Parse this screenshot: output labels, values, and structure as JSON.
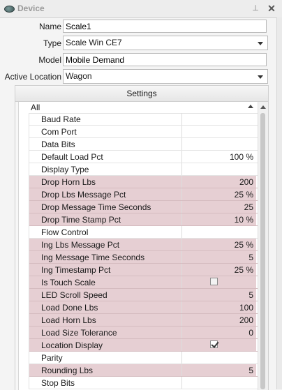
{
  "window": {
    "title": "Device",
    "icon": "device-icon",
    "pin_glyph": "📌",
    "close_glyph": "✕"
  },
  "form": {
    "name": {
      "label": "Name",
      "value": "Scale1"
    },
    "type": {
      "label": "Type",
      "value": "Scale Win CE7"
    },
    "model": {
      "label": "Model",
      "value": "Mobile Demand"
    },
    "location": {
      "label": "Active Location",
      "value": "Wagon"
    }
  },
  "settings": {
    "header": "Settings",
    "category": "All",
    "rows": [
      {
        "name": "Baud Rate",
        "value": "",
        "highlight": false
      },
      {
        "name": "Com Port",
        "value": "",
        "highlight": false
      },
      {
        "name": "Data Bits",
        "value": "",
        "highlight": false
      },
      {
        "name": "Default Load Pct",
        "value": "100 %",
        "highlight": false
      },
      {
        "name": "Display Type",
        "value": "",
        "highlight": false
      },
      {
        "name": "Drop Horn Lbs",
        "value": "200",
        "highlight": true
      },
      {
        "name": "Drop Lbs Message Pct",
        "value": "25 %",
        "highlight": true
      },
      {
        "name": "Drop Message Time Seconds",
        "value": "25",
        "highlight": true
      },
      {
        "name": "Drop Time Stamp Pct",
        "value": "10 %",
        "highlight": true
      },
      {
        "name": "Flow Control",
        "value": "",
        "highlight": false
      },
      {
        "name": "Ing Lbs Message Pct",
        "value": "25 %",
        "highlight": true
      },
      {
        "name": "Ing Message Time Seconds",
        "value": "5",
        "highlight": true
      },
      {
        "name": "Ing Timestamp Pct",
        "value": "25 %",
        "highlight": true
      },
      {
        "name": "Is Touch Scale",
        "value": "",
        "checkbox": false,
        "highlight": true
      },
      {
        "name": "LED Scroll Speed",
        "value": "5",
        "highlight": true
      },
      {
        "name": "Load Done Lbs",
        "value": "100",
        "highlight": true
      },
      {
        "name": "Load Horn Lbs",
        "value": "200",
        "highlight": true
      },
      {
        "name": "Load Size Tolerance",
        "value": "0",
        "highlight": true
      },
      {
        "name": "Location Display",
        "value": "",
        "checkbox": true,
        "highlight": true
      },
      {
        "name": "Parity",
        "value": "",
        "highlight": false
      },
      {
        "name": "Rounding Lbs",
        "value": "5",
        "highlight": true
      },
      {
        "name": "Stop Bits",
        "value": "",
        "highlight": false
      }
    ]
  }
}
